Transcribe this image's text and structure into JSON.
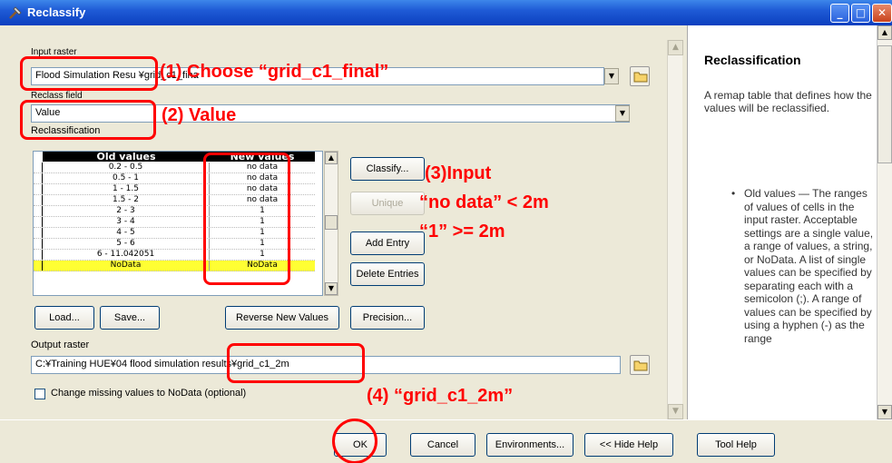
{
  "window": {
    "title": "Reclassify"
  },
  "input_raster": {
    "label": "Input raster",
    "value": "Flood Simulation Resu ¥grid_c1_fina"
  },
  "reclass_field": {
    "label": "Reclass field",
    "value": "Value"
  },
  "reclassification": {
    "label": "Reclassification",
    "headers": {
      "old": "Old values",
      "new": "New values"
    },
    "rows": [
      {
        "old": "0.2 - 0.5",
        "new": "no data"
      },
      {
        "old": "0.5 - 1",
        "new": "no data"
      },
      {
        "old": "1 - 1.5",
        "new": "no data"
      },
      {
        "old": "1.5 - 2",
        "new": "no data"
      },
      {
        "old": "2 - 3",
        "new": "1"
      },
      {
        "old": "3 - 4",
        "new": "1"
      },
      {
        "old": "4 - 5",
        "new": "1"
      },
      {
        "old": "5 - 6",
        "new": "1"
      },
      {
        "old": "6 - 11.042051",
        "new": "1"
      },
      {
        "old": "NoData",
        "new": "NoData"
      }
    ]
  },
  "buttons": {
    "classify": "Classify...",
    "unique": "Unique",
    "add_entry": "Add Entry",
    "delete_entries": "Delete Entries",
    "load": "Load...",
    "save": "Save...",
    "reverse": "Reverse New Values",
    "precision": "Precision...",
    "ok": "OK",
    "cancel": "Cancel",
    "environments": "Environments...",
    "hide_help": "<< Hide Help",
    "tool_help": "Tool Help"
  },
  "output_raster": {
    "label": "Output raster",
    "value": "C:¥Training HUE¥04 flood simulation results¥grid_c1_2m"
  },
  "missing_values": {
    "label": "Change missing values to NoData (optional)",
    "checked": false
  },
  "annotations": {
    "a1": "(1)  Choose “grid_c1_final”",
    "a2": "(2)  Value",
    "a3_line1": "(3)Input",
    "a3_line2": "“no data” < 2m",
    "a3_line3": "“1” >= 2m",
    "a4": "(4)  “grid_c1_2m”"
  },
  "help": {
    "title": "Reclassification",
    "description": "A remap table that defines how the values will be reclassified.",
    "bullet": "Old values — The ranges of values of cells in the input raster. Acceptable settings are a single value, a range of values, a string, or NoData. A list of single values can be specified by separating each with a semicolon (;). A range of values can be specified by using a hyphen (-) as the range"
  },
  "colors": {
    "annotation": "#ff0000",
    "titlebar": "#1f5bd6",
    "highlight_row": "#ffff33"
  }
}
